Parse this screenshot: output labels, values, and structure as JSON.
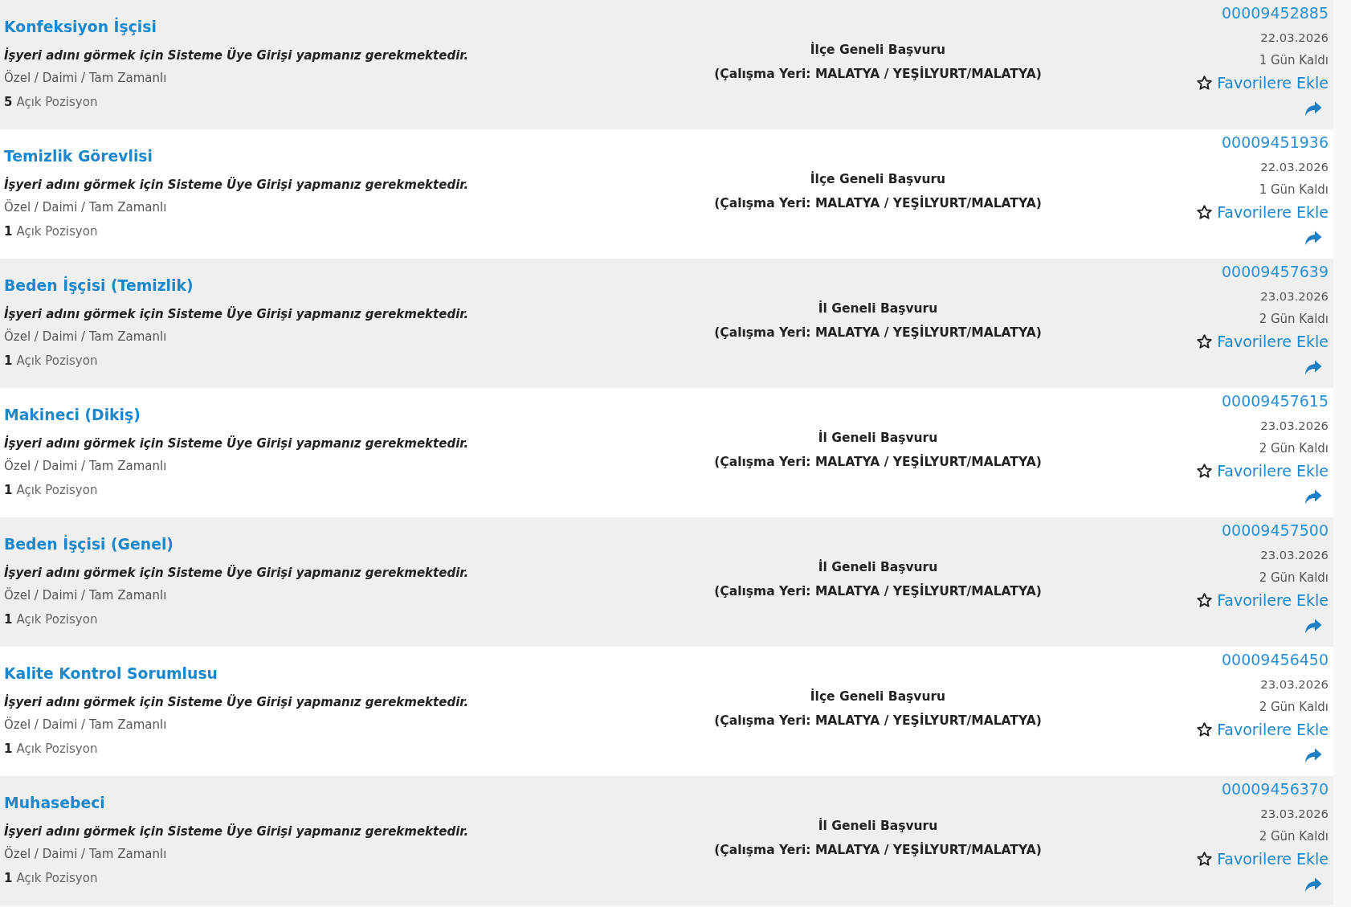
{
  "jobs": [
    {
      "title": "Konfeksiyon İşçisi",
      "employer_note": "İşyeri adını görmek için Sisteme Üye Girişi yapmanız gerekmektedir.",
      "employment_type": "Özel / Daimi / Tam Zamanlı",
      "open_positions": "5",
      "open_positions_label": "Açık Pozisyon",
      "application_scope": "İlçe Geneli Başvuru",
      "work_location": "(Çalışma Yeri: MALATYA / YEŞİLYURT/MALATYA)",
      "listing_number": "00009452885",
      "date": "22.03.2026",
      "days_left": "1 Gün Kaldı",
      "favorite_label": "Favorilere Ekle"
    },
    {
      "title": "Temizlik Görevlisi",
      "employer_note": "İşyeri adını görmek için Sisteme Üye Girişi yapmanız gerekmektedir.",
      "employment_type": "Özel / Daimi / Tam Zamanlı",
      "open_positions": "1",
      "open_positions_label": "Açık Pozisyon",
      "application_scope": "İlçe Geneli Başvuru",
      "work_location": "(Çalışma Yeri: MALATYA / YEŞİLYURT/MALATYA)",
      "listing_number": "00009451936",
      "date": "22.03.2026",
      "days_left": "1 Gün Kaldı",
      "favorite_label": "Favorilere Ekle"
    },
    {
      "title": "Beden İşçisi (Temizlik)",
      "employer_note": "İşyeri adını görmek için Sisteme Üye Girişi yapmanız gerekmektedir.",
      "employment_type": "Özel / Daimi / Tam Zamanlı",
      "open_positions": "1",
      "open_positions_label": "Açık Pozisyon",
      "application_scope": "İl Geneli Başvuru",
      "work_location": "(Çalışma Yeri: MALATYA / YEŞİLYURT/MALATYA)",
      "listing_number": "00009457639",
      "date": "23.03.2026",
      "days_left": "2 Gün Kaldı",
      "favorite_label": "Favorilere Ekle"
    },
    {
      "title": "Makineci (Dikiş)",
      "employer_note": "İşyeri adını görmek için Sisteme Üye Girişi yapmanız gerekmektedir.",
      "employment_type": "Özel / Daimi / Tam Zamanlı",
      "open_positions": "1",
      "open_positions_label": "Açık Pozisyon",
      "application_scope": "İl Geneli Başvuru",
      "work_location": "(Çalışma Yeri: MALATYA / YEŞİLYURT/MALATYA)",
      "listing_number": "00009457615",
      "date": "23.03.2026",
      "days_left": "2 Gün Kaldı",
      "favorite_label": "Favorilere Ekle"
    },
    {
      "title": "Beden İşçisi (Genel)",
      "employer_note": "İşyeri adını görmek için Sisteme Üye Girişi yapmanız gerekmektedir.",
      "employment_type": "Özel / Daimi / Tam Zamanlı",
      "open_positions": "1",
      "open_positions_label": "Açık Pozisyon",
      "application_scope": "İl Geneli Başvuru",
      "work_location": "(Çalışma Yeri: MALATYA / YEŞİLYURT/MALATYA)",
      "listing_number": "00009457500",
      "date": "23.03.2026",
      "days_left": "2 Gün Kaldı",
      "favorite_label": "Favorilere Ekle"
    },
    {
      "title": "Kalite Kontrol Sorumlusu",
      "employer_note": "İşyeri adını görmek için Sisteme Üye Girişi yapmanız gerekmektedir.",
      "employment_type": "Özel / Daimi / Tam Zamanlı",
      "open_positions": "1",
      "open_positions_label": "Açık Pozisyon",
      "application_scope": "İlçe Geneli Başvuru",
      "work_location": "(Çalışma Yeri: MALATYA / YEŞİLYURT/MALATYA)",
      "listing_number": "00009456450",
      "date": "23.03.2026",
      "days_left": "2 Gün Kaldı",
      "favorite_label": "Favorilere Ekle"
    },
    {
      "title": "Muhasebeci",
      "employer_note": "İşyeri adını görmek için Sisteme Üye Girişi yapmanız gerekmektedir.",
      "employment_type": "Özel / Daimi / Tam Zamanlı",
      "open_positions": "1",
      "open_positions_label": "Açık Pozisyon",
      "application_scope": "İl Geneli Başvuru",
      "work_location": "(Çalışma Yeri: MALATYA / YEŞİLYURT/MALATYA)",
      "listing_number": "00009456370",
      "date": "23.03.2026",
      "days_left": "2 Gün Kaldı",
      "favorite_label": "Favorilere Ekle"
    }
  ]
}
